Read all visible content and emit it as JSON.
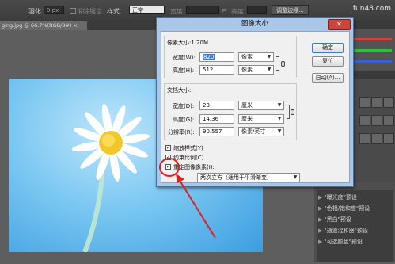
{
  "optbar": {
    "feather_label": "羽化：",
    "feather_value": "0 px",
    "antialias_label": "消除锯齿",
    "style_label": "样式：",
    "style_value": "正常",
    "width_label": "宽度：",
    "height_label": "高度：",
    "refine_edge_label": "调整边缘..."
  },
  "watermark": "fun48.com",
  "document_tab": "ging.jpg @ 66.7%(RGB/8#) ×",
  "dialog": {
    "title": "图像大小",
    "close_glyph": "✕",
    "pixel_dimensions": {
      "legend": "像素大小:1.20M",
      "width_label": "宽度(W):",
      "width_value": "820",
      "width_unit": "像素",
      "height_label": "高度(H):",
      "height_value": "512",
      "height_unit": "像素"
    },
    "document_size": {
      "legend": "文档大小:",
      "width_label": "宽度(D):",
      "width_value": "23",
      "width_unit": "厘米",
      "height_label": "高度(G):",
      "height_value": "14.36",
      "height_unit": "厘米",
      "resolution_label": "分辨率(R):",
      "resolution_value": "90.557",
      "resolution_unit": "像素/英寸"
    },
    "buttons": {
      "ok": "确定",
      "reset": "复位",
      "auto": "自动(A)..."
    },
    "options": {
      "scale_styles": "缩放样式(Y)",
      "constrain_proportions": "约束比例(C)",
      "resample": "重定图像像素(I):",
      "resample_method": "两次立方（适用于平滑渐变）"
    }
  },
  "adjustments": {
    "items": [
      "\"曝光度\"预设",
      "\"色相/饱和度\"预设",
      "\"黑白\"预设",
      "\"通道混和器\"预设",
      "\"可选颜色\"预设"
    ]
  },
  "colors": {
    "dialog_frame": "#a9c7e8",
    "annotation": "#e02020",
    "highlight": "#3b7ad8"
  }
}
